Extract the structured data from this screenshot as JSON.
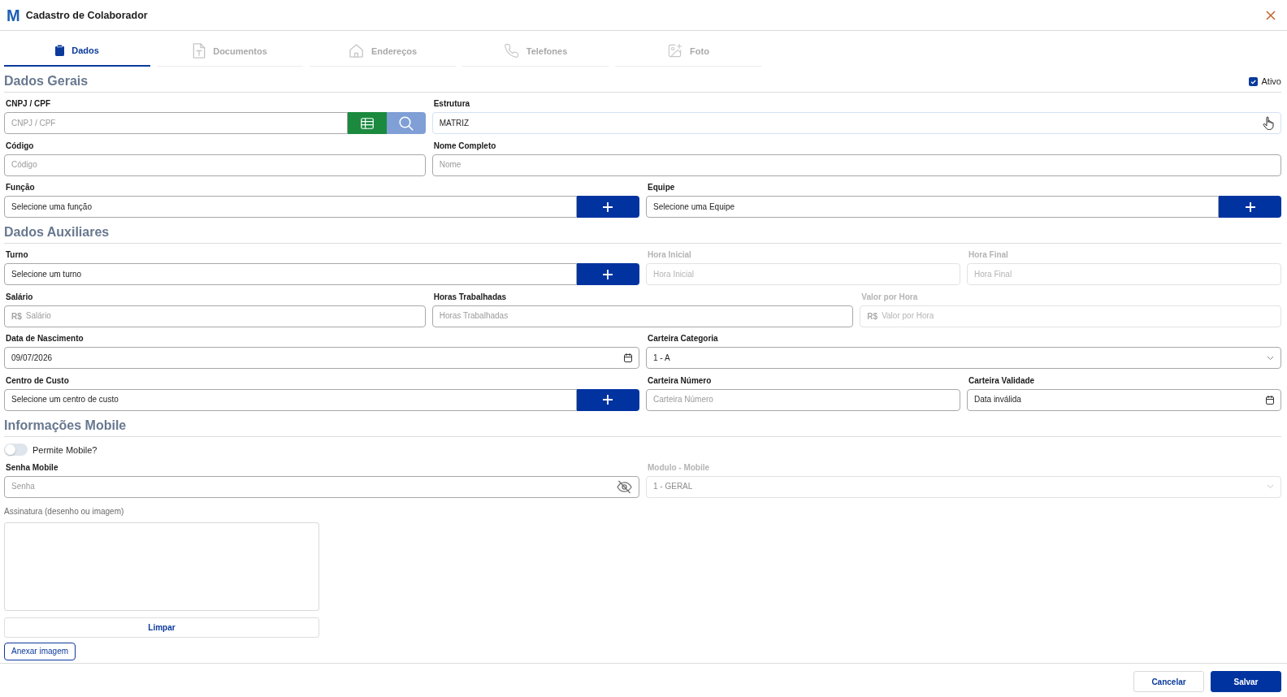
{
  "window": {
    "logo": "M",
    "title": "Cadastro de Colaborador"
  },
  "tabs": [
    {
      "label": "Dados",
      "selected": true
    },
    {
      "label": "Documentos",
      "selected": false
    },
    {
      "label": "Endereços",
      "selected": false
    },
    {
      "label": "Telefones",
      "selected": false
    },
    {
      "label": "Foto",
      "selected": false
    }
  ],
  "sections": [
    {
      "title": "Dados Gerais",
      "active_checkbox": {
        "label": "Ativo",
        "checked": true
      },
      "rows": [
        [
          {
            "label": "CNPJ / CPF",
            "kind": "search",
            "placeholder": "CNPJ / CPF",
            "disabled": false,
            "hovered": false
          },
          {
            "label": "Estrutura",
            "kind": "text",
            "value": "MATRIZ",
            "disabled": false,
            "hovered": true
          }
        ],
        [
          {
            "label": "Código",
            "kind": "text",
            "placeholder": "Código",
            "disabled": false,
            "hovered": false
          },
          {
            "label": "Nome Completo",
            "kind": "text",
            "placeholder": "Nome",
            "disabled": false,
            "hovered": false
          }
        ],
        [
          {
            "label": "Função",
            "kind": "add-select",
            "value": "Selecione uma função",
            "disabled": false,
            "hovered": false
          },
          {
            "label": "Equipe",
            "kind": "add-select",
            "value": "Selecione uma Equipe",
            "disabled": false,
            "hovered": false
          }
        ]
      ]
    },
    {
      "title": "Dados Auxiliares",
      "rows": [
        [
          {
            "label": "Turno",
            "kind": "add-select",
            "value": "Selecione um turno",
            "disabled": false,
            "hovered": false
          },
          {
            "label": "Hora Inicial",
            "kind": "text",
            "placeholder": "Hora Inicial",
            "disabled": true,
            "hovered": false
          },
          {
            "label": "Hora Final",
            "kind": "text",
            "placeholder": "Hora Final",
            "disabled": true,
            "hovered": false
          }
        ],
        [
          {
            "label": "Salário",
            "kind": "currency",
            "prefix": "R$",
            "placeholder": "Salário",
            "disabled": false,
            "hovered": false
          },
          {
            "label": "Horas Trabalhadas",
            "kind": "text",
            "placeholder": "Horas Trabalhadas",
            "disabled": false,
            "hovered": false
          },
          {
            "label": "Valor por Hora",
            "kind": "currency",
            "prefix": "R$",
            "placeholder": "Valor por Hora",
            "disabled": true,
            "hovered": false
          }
        ],
        [
          {
            "label": "Data de Nascimento",
            "kind": "date",
            "value": "09/07/2026",
            "disabled": false,
            "hovered": false
          },
          {
            "label": "Carteira Categoria",
            "kind": "select",
            "value": "1 - A",
            "disabled": false,
            "hovered": false
          }
        ],
        [
          {
            "label": "Centro de Custo",
            "kind": "add-select",
            "value": "Selecione um centro de custo",
            "disabled": false,
            "hovered": false
          },
          {
            "label": "Carteira Número",
            "kind": "text",
            "placeholder": "Carteira Número",
            "disabled": false,
            "hovered": false
          },
          {
            "label": "Carteira Validade",
            "kind": "date",
            "value": "Data inválida",
            "disabled": false,
            "hovered": false
          }
        ]
      ]
    },
    {
      "title": "Informações Mobile",
      "toggle": {
        "label": "Permite Mobile?",
        "on": false
      },
      "rows": [
        [
          {
            "label": "Senha Mobile",
            "kind": "password",
            "placeholder": "Senha",
            "disabled": false,
            "hovered": false
          },
          {
            "label": "Modulo - Mobile",
            "kind": "select",
            "value": "1 - GERAL",
            "disabled": true,
            "hovered": false
          }
        ]
      ],
      "signature": {
        "label": "Assinatura (desenho ou imagem)",
        "clear_button": "Limpar",
        "attach_button": "Anexar imagem"
      }
    }
  ],
  "footer_buttons": [
    {
      "label": "Cancelar",
      "kind": "secondary"
    },
    {
      "label": "Salvar",
      "kind": "primary"
    }
  ]
}
